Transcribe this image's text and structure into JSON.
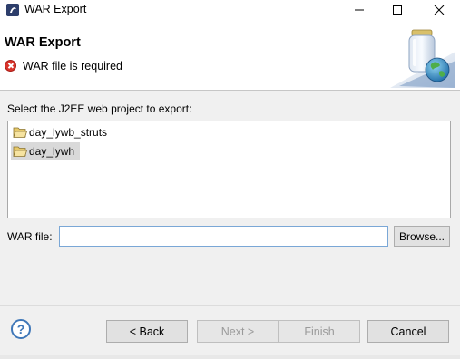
{
  "window": {
    "title": "WAR Export",
    "controls": [
      "minimize-icon",
      "maximize-icon",
      "close-icon"
    ]
  },
  "header": {
    "title": "WAR Export",
    "message": "WAR file is required",
    "message_icon": "error-icon",
    "banner_icon": "war-jar-globe-icon"
  },
  "main": {
    "prompt": "Select the J2EE web project to export:",
    "projects": [
      {
        "label": "day_lywb_struts",
        "icon": "open-folder-icon",
        "selected": false
      },
      {
        "label": "day_lywh",
        "icon": "open-folder-icon",
        "selected": true
      }
    ],
    "war_file": {
      "label": "WAR file:",
      "value": "",
      "browse_label": "Browse..."
    }
  },
  "footer": {
    "help_icon": "help-icon",
    "back_label": "< Back",
    "next_label": "Next >",
    "finish_label": "Finish",
    "cancel_label": "Cancel"
  },
  "colors": {
    "error": "#d9332a",
    "selection": "#d9d9d9",
    "help": "#3f77b8",
    "input_border": "#7aa7d6"
  }
}
